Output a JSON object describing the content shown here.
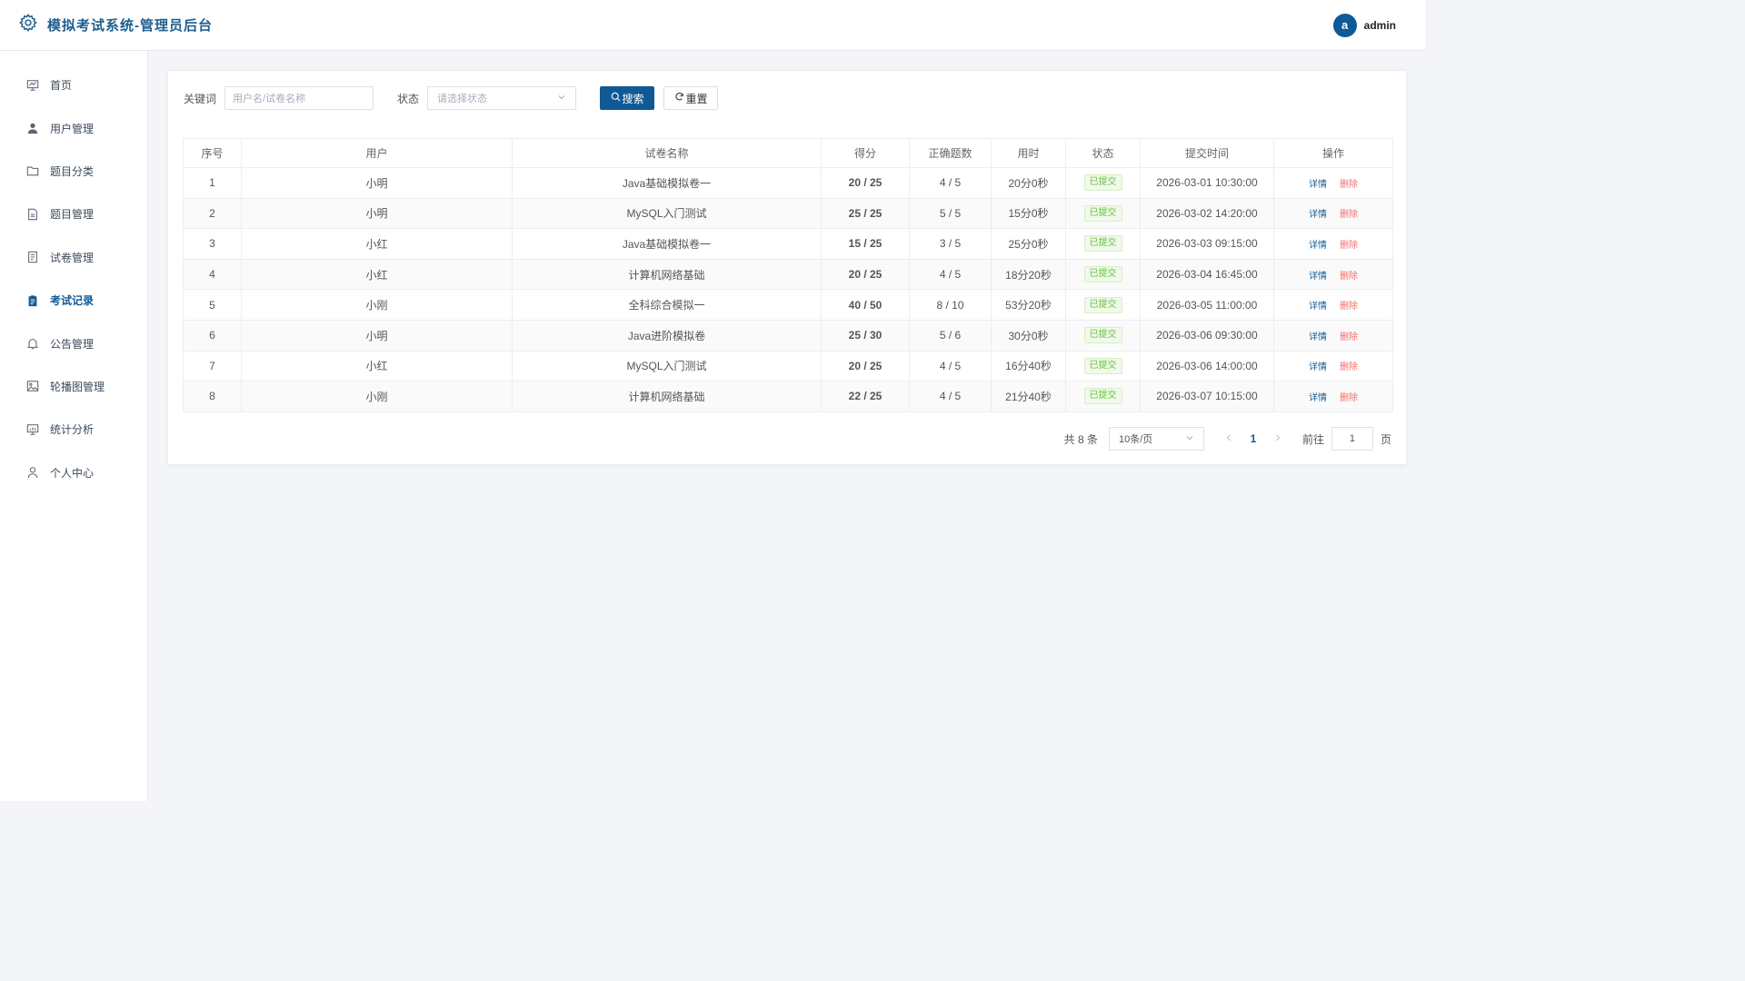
{
  "header": {
    "title": "模拟考试系统-管理员后台",
    "avatar_letter": "a",
    "username": "admin",
    "accent": "#0f5a96"
  },
  "sidebar": {
    "items": [
      {
        "label": "首页",
        "icon": "dashboard-icon"
      },
      {
        "label": "用户管理",
        "icon": "user-icon"
      },
      {
        "label": "题目分类",
        "icon": "folder-icon"
      },
      {
        "label": "题目管理",
        "icon": "document-icon"
      },
      {
        "label": "试卷管理",
        "icon": "paper-icon"
      },
      {
        "label": "考试记录",
        "icon": "clipboard-icon",
        "active": true
      },
      {
        "label": "公告管理",
        "icon": "bell-icon"
      },
      {
        "label": "轮播图管理",
        "icon": "image-icon"
      },
      {
        "label": "统计分析",
        "icon": "chart-board-icon"
      },
      {
        "label": "个人中心",
        "icon": "person-icon"
      }
    ]
  },
  "filter": {
    "keyword_label": "关键词",
    "keyword_placeholder": "用户名/试卷名称",
    "status_label": "状态",
    "status_placeholder": "请选择状态",
    "search_label": "搜索",
    "reset_label": "重置"
  },
  "table": {
    "columns": [
      "序号",
      "用户",
      "试卷名称",
      "得分",
      "正确题数",
      "用时",
      "状态",
      "提交时间",
      "操作"
    ],
    "rows": [
      {
        "no": "1",
        "user": "小明",
        "paper": "Java基础模拟卷一",
        "score": "20 / 25",
        "correct": "4 / 5",
        "duration": "20分0秒",
        "status": "已提交",
        "time": "2026-03-01 10:30:00"
      },
      {
        "no": "2",
        "user": "小明",
        "paper": "MySQL入门测试",
        "score": "25 / 25",
        "correct": "5 / 5",
        "duration": "15分0秒",
        "status": "已提交",
        "time": "2026-03-02 14:20:00"
      },
      {
        "no": "3",
        "user": "小红",
        "paper": "Java基础模拟卷一",
        "score": "15 / 25",
        "correct": "3 / 5",
        "duration": "25分0秒",
        "status": "已提交",
        "time": "2026-03-03 09:15:00"
      },
      {
        "no": "4",
        "user": "小红",
        "paper": "计算机网络基础",
        "score": "20 / 25",
        "correct": "4 / 5",
        "duration": "18分20秒",
        "status": "已提交",
        "time": "2026-03-04 16:45:00"
      },
      {
        "no": "5",
        "user": "小刚",
        "paper": "全科综合模拟一",
        "score": "40 / 50",
        "correct": "8 / 10",
        "duration": "53分20秒",
        "status": "已提交",
        "time": "2026-03-05 11:00:00"
      },
      {
        "no": "6",
        "user": "小明",
        "paper": "Java进阶模拟卷",
        "score": "25 / 30",
        "correct": "5 / 6",
        "duration": "30分0秒",
        "status": "已提交",
        "time": "2026-03-06 09:30:00"
      },
      {
        "no": "7",
        "user": "小红",
        "paper": "MySQL入门测试",
        "score": "20 / 25",
        "correct": "4 / 5",
        "duration": "16分40秒",
        "status": "已提交",
        "time": "2026-03-06 14:00:00"
      },
      {
        "no": "8",
        "user": "小刚",
        "paper": "计算机网络基础",
        "score": "22 / 25",
        "correct": "4 / 5",
        "duration": "21分40秒",
        "status": "已提交",
        "time": "2026-03-07 10:15:00"
      }
    ],
    "detail_label": "详情",
    "delete_label": "删除"
  },
  "pagination": {
    "total_text": "共 8 条",
    "page_size": "10条/页",
    "current_page": "1",
    "goto_prefix": "前往",
    "goto_value": "1",
    "goto_suffix": "页"
  }
}
